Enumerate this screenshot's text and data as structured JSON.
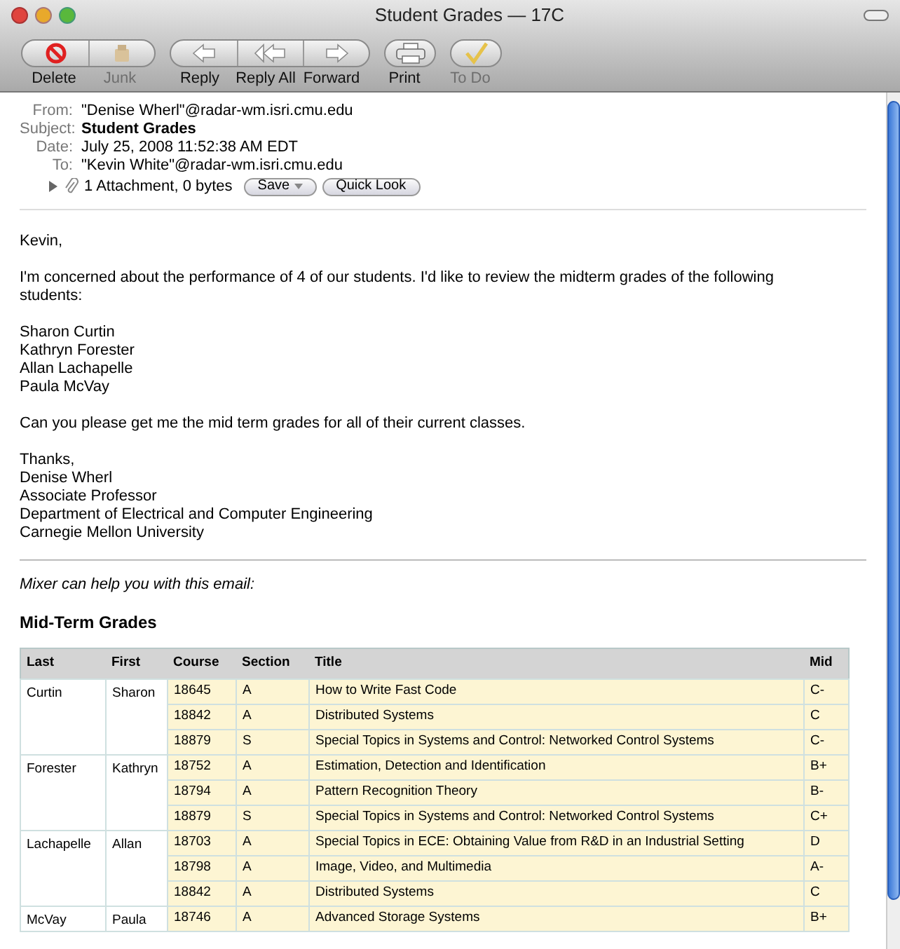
{
  "window": {
    "title": "Student Grades — 17C"
  },
  "toolbar": {
    "groups": [
      {
        "buttons": [
          {
            "label": "Delete",
            "kind": "delete",
            "disabled": false
          },
          {
            "label": "Junk",
            "kind": "junk",
            "disabled": true
          }
        ]
      },
      {
        "buttons": [
          {
            "label": "Reply",
            "kind": "reply",
            "disabled": false
          },
          {
            "label": "Reply All",
            "kind": "reply-all",
            "disabled": false
          },
          {
            "label": "Forward",
            "kind": "forward",
            "disabled": false
          }
        ]
      },
      {
        "buttons": [
          {
            "label": "Print",
            "kind": "print",
            "disabled": false
          }
        ]
      },
      {
        "buttons": [
          {
            "label": "To Do",
            "kind": "todo",
            "disabled": true
          }
        ]
      }
    ]
  },
  "header": {
    "fields": [
      {
        "label": "From:",
        "value": "\"Denise Wherl\"@radar-wm.isri.cmu.edu",
        "bold": false
      },
      {
        "label": "Subject:",
        "value": "Student Grades",
        "bold": true
      },
      {
        "label": "Date:",
        "value": "July 25, 2008 11:52:38 AM EDT",
        "bold": false
      },
      {
        "label": "To:",
        "value": "\"Kevin White\"@radar-wm.isri.cmu.edu",
        "bold": false
      }
    ],
    "attachment": {
      "text": "1 Attachment, 0 bytes",
      "expanded": false,
      "buttons": [
        {
          "label": "Save",
          "kind": "menu"
        },
        {
          "label": "Quick Look",
          "kind": "plain"
        }
      ]
    }
  },
  "body": {
    "paragraphs": [
      [
        "Kevin,"
      ],
      [
        "I'm concerned about the performance of 4 of our students. I'd like to review the midterm grades of the following students:"
      ],
      [
        "Sharon Curtin",
        "Kathryn Forester",
        "Allan Lachapelle",
        "Paula McVay"
      ],
      [
        "Can you please get me the mid term grades for all of their current classes."
      ],
      [
        "Thanks,",
        "Denise Wherl",
        "Associate Professor",
        "Department of Electrical and Computer Engineering",
        "Carnegie Mellon University"
      ]
    ]
  },
  "mixer": {
    "note": "Mixer can help you with this email:",
    "heading": "Mid-Term Grades",
    "table": {
      "columns": [
        "Last",
        "First",
        "Course",
        "Section",
        "Title",
        "Mid"
      ],
      "students": [
        {
          "last": "Curtin",
          "first": "Sharon",
          "rows": [
            [
              "18645",
              "A",
              "How to Write Fast Code",
              "C-"
            ],
            [
              "18842",
              "A",
              "Distributed Systems",
              "C"
            ],
            [
              "18879",
              "S",
              "Special Topics in Systems and Control: Networked Control Systems",
              "C-"
            ]
          ]
        },
        {
          "last": "Forester",
          "first": "Kathryn",
          "rows": [
            [
              "18752",
              "A",
              "Estimation, Detection and Identification",
              "B+"
            ],
            [
              "18794",
              "A",
              "Pattern Recognition Theory",
              "B-"
            ],
            [
              "18879",
              "S",
              "Special Topics in Systems and Control: Networked Control Systems",
              "C+"
            ]
          ]
        },
        {
          "last": "Lachapelle",
          "first": "Allan",
          "rows": [
            [
              "18703",
              "A",
              "Special Topics in ECE: Obtaining Value from R&D in an Industrial Setting",
              "D"
            ],
            [
              "18798",
              "A",
              "Image, Video, and Multimedia",
              "A-"
            ],
            [
              "18842",
              "A",
              "Distributed Systems",
              "C"
            ]
          ]
        },
        {
          "last": "McVay",
          "first": "Paula",
          "rows": [
            [
              "18746",
              "A",
              "Advanced Storage Systems",
              "B+"
            ]
          ]
        }
      ]
    }
  }
}
